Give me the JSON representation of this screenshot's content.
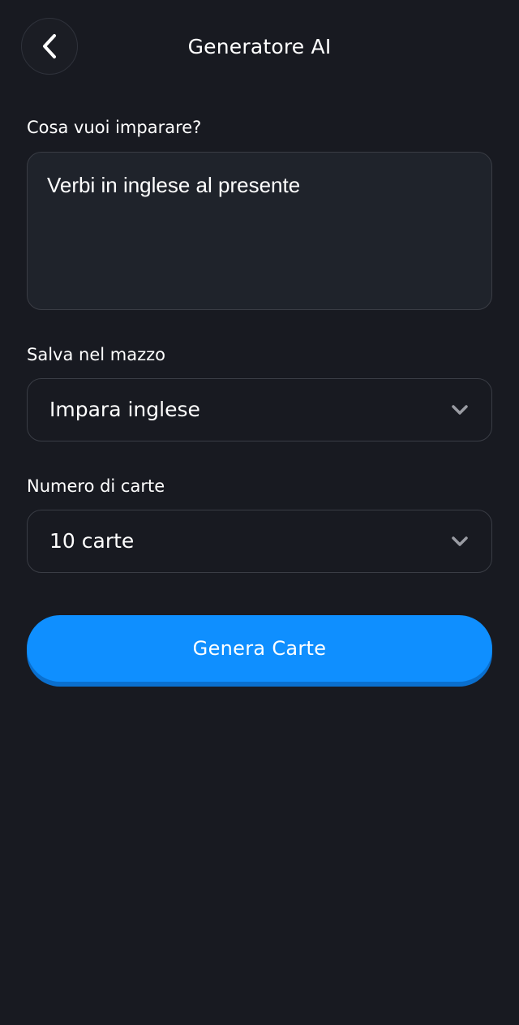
{
  "header": {
    "title": "Generatore AI",
    "back_icon": "chevron-left-icon"
  },
  "form": {
    "topic": {
      "label": "Cosa vuoi imparare?",
      "value": "Verbi in inglese al presente"
    },
    "deck": {
      "label": "Salva nel mazzo",
      "selected": "Impara inglese",
      "icon": "chevron-down-icon"
    },
    "count": {
      "label": "Numero di carte",
      "selected": "10 carte",
      "icon": "chevron-down-icon"
    },
    "submit_label": "Genera Carte"
  },
  "colors": {
    "background": "#181a21",
    "input_background": "#1f232b",
    "border": "#3a3d45",
    "primary": "#0f8fff",
    "chevron": "#9a9ca3"
  }
}
